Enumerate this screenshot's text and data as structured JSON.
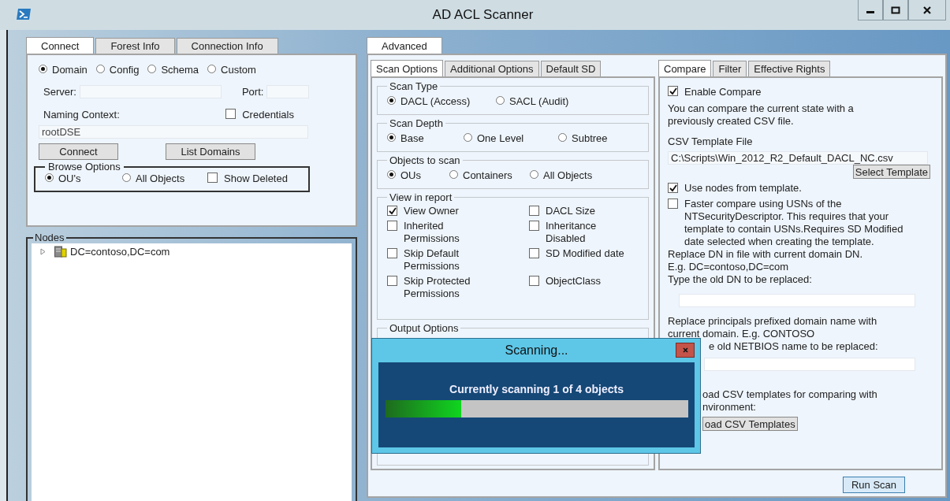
{
  "window": {
    "title": "AD ACL Scanner"
  },
  "left_tabs": [
    {
      "label": "Connect",
      "selected": true
    },
    {
      "label": "Forest Info",
      "selected": false
    },
    {
      "label": "Connection Info",
      "selected": false
    }
  ],
  "connect": {
    "sources": [
      {
        "label": "Domain",
        "selected": true
      },
      {
        "label": "Config",
        "selected": false
      },
      {
        "label": "Schema",
        "selected": false
      },
      {
        "label": "Custom",
        "selected": false
      }
    ],
    "server_label": "Server:",
    "port_label": "Port:",
    "naming_context_label": "Naming Context:",
    "credentials": {
      "label": "Credentials",
      "checked": false
    },
    "naming_context": {
      "value": "rootDSE"
    },
    "connect_button": "Connect",
    "list_domains_button": "List Domains",
    "browse_options": {
      "title": "Browse Options",
      "options": [
        {
          "label": "OU's",
          "selected": true
        },
        {
          "label": "All Objects",
          "selected": false
        }
      ],
      "show_deleted": {
        "label": "Show Deleted",
        "checked": false
      }
    }
  },
  "nodes": {
    "title": "Nodes",
    "items": [
      {
        "label": "DC=contoso,DC=com",
        "expanded": false
      }
    ]
  },
  "advanced_tab": {
    "label": "Advanced",
    "selected": true
  },
  "scan_tabs": [
    {
      "label": "Scan Options",
      "selected": true
    },
    {
      "label": "Additional Options",
      "selected": false
    },
    {
      "label": "Default SD",
      "selected": false
    }
  ],
  "radio_groups": [
    {
      "title": "Scan Type",
      "options": [
        {
          "label": "DACL (Access)",
          "selected": true
        },
        {
          "label": "SACL (Audit)",
          "selected": false
        }
      ]
    },
    {
      "title": "Scan Depth",
      "options": [
        {
          "label": "Base",
          "selected": true
        },
        {
          "label": "One Level",
          "selected": false
        },
        {
          "label": "Subtree",
          "selected": false
        }
      ]
    },
    {
      "title": "Objects to scan",
      "options": [
        {
          "label": "OUs",
          "selected": true
        },
        {
          "label": "Containers",
          "selected": false
        },
        {
          "label": "All Objects",
          "selected": false
        }
      ]
    }
  ],
  "view_in_report": {
    "title": "View in report",
    "items": [
      {
        "label": "View Owner",
        "checked": true
      },
      {
        "label": "DACL Size",
        "checked": false
      },
      {
        "label": "Inherited Permissions",
        "checked": false
      },
      {
        "label": "Inheritance Disabled",
        "checked": false
      },
      {
        "label": "Skip Default Permissions",
        "checked": false
      },
      {
        "label": "SD Modified date",
        "checked": false
      },
      {
        "label": "Skip Protected Permissions",
        "checked": false
      },
      {
        "label": "ObjectClass",
        "checked": false
      }
    ]
  },
  "output_options": {
    "title": "Output Options"
  },
  "compare_tabs": [
    {
      "label": "Compare",
      "selected": true
    },
    {
      "label": "Filter",
      "selected": false
    },
    {
      "label": "Effective Rights",
      "selected": false
    }
  ],
  "compare": {
    "enable_compare": {
      "label": "Enable Compare",
      "checked": true
    },
    "description": "You can compare the current state with a previously created CSV file.",
    "template_label": "CSV Template File",
    "template_field": {
      "value": "C:\\Scripts\\Win_2012_R2_Default_DACL_NC.csv"
    },
    "select_template_button": "Select Template",
    "options": [
      {
        "label": "Use nodes from template.",
        "checked": true
      },
      {
        "label": "Faster compare using USNs of the NTSecurityDescriptor. This requires that your template to contain USNs.Requires SD Modified date selected when creating the template.",
        "checked": false
      }
    ],
    "replace_dn_lines": [
      "Replace DN in file with current domain DN.",
      "E.g. DC=contoso,DC=com",
      "Type the old DN to be replaced:"
    ],
    "replace_principals": "Replace principals prefixed domain name with current domain. E.g. CONTOSO",
    "netbios_label": "e old NETBIOS name to be replaced:",
    "download_lines": [
      "oad CSV templates for comparing with",
      "nvironment:"
    ],
    "download_button": "oad CSV Templates"
  },
  "run_scan_button": "Run Scan",
  "dialog": {
    "title": "Scanning...",
    "message": "Currently scanning 1 of 4 objects",
    "level": 0.25
  }
}
